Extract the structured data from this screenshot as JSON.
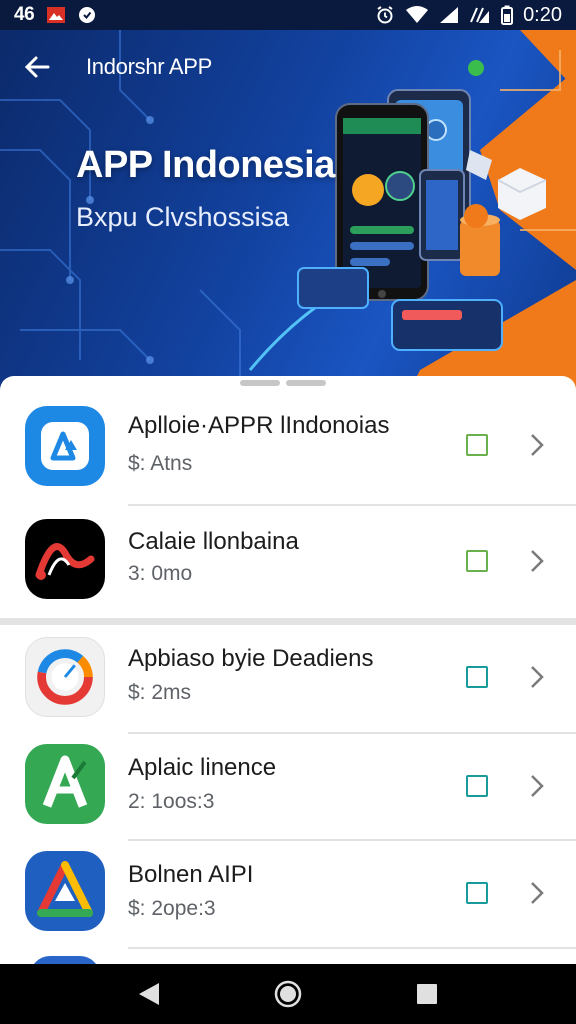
{
  "status_bar": {
    "network": "46",
    "time": "0:20"
  },
  "hero": {
    "top_title": "Indorshr APP",
    "title": "APP Indonesia",
    "subtitle": "Bxpu Clvshossisa"
  },
  "apps": [
    {
      "name": "Aplloie·APPR lIndonoias",
      "meta": "$: Atns",
      "icon": "app-icon-blue-a",
      "check_color": "#6ab04c"
    },
    {
      "name": "Calaie llonbaina",
      "meta": "3: 0mo",
      "icon": "app-icon-black-wave",
      "check_color": "#6ab04c"
    },
    {
      "name": "Apbiaso byie Deadiens",
      "meta": "$: 2ms",
      "icon": "app-icon-ring",
      "check_color": "#1a9b9b"
    },
    {
      "name": "Aplaic linence",
      "meta": "2: 1oos:3",
      "icon": "app-icon-green-a",
      "check_color": "#1a9b9b"
    },
    {
      "name": "Bolnen AIPI",
      "meta": "$: 2ope:3",
      "icon": "app-icon-triangle",
      "check_color": "#1a9b9b"
    }
  ],
  "colors": {
    "hero_blue": "#12419e",
    "accent_orange": "#f07a1a",
    "check_green": "#6ab04c",
    "check_teal": "#1a9b9b"
  }
}
